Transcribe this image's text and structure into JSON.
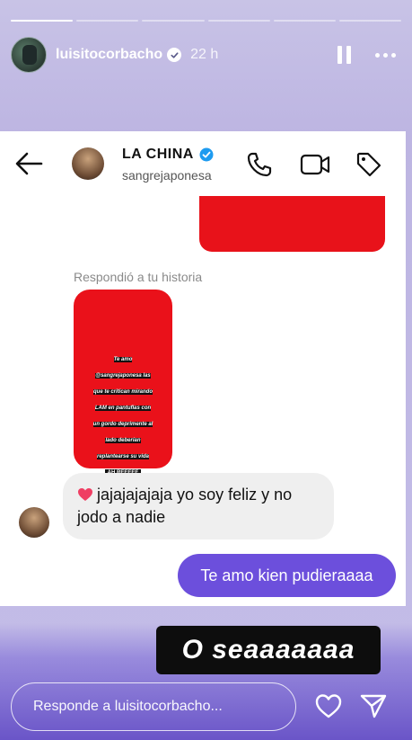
{
  "story": {
    "progress": [
      1,
      0,
      0,
      0,
      0,
      0
    ],
    "username": "luisitocorbacho",
    "time_ago": "22 h"
  },
  "dm": {
    "contact_name": "LA CHINA",
    "contact_handle": "sangrejaponesa",
    "replied_label": "Respondió a tu historia",
    "story_sticker": {
      "lines": [
        "Te amo",
        "@sangrejaponesa las",
        "que te critican mirando",
        "LAM en pantuflas con",
        "un gordo deprimente al",
        "lado deberían",
        "replantearse su vida"
      ],
      "cta": "AH REEEEE"
    },
    "incoming_message": "jajajajajaja yo soy feliz y no jodo a nadie",
    "outgoing_message": "Te amo kien pudieraaaa",
    "colors": {
      "outgoing_bubble": "#6c4fdc",
      "story_red": "#ea111a"
    }
  },
  "caption": "O seaaaaaaa",
  "reply": {
    "placeholder": "Responde a luisitocorbacho..."
  },
  "icons": [
    "pause-icon",
    "more-icon",
    "back-arrow-icon",
    "phone-icon",
    "video-camera-icon",
    "tag-icon",
    "heart-icon",
    "send-icon",
    "verified-icon"
  ]
}
